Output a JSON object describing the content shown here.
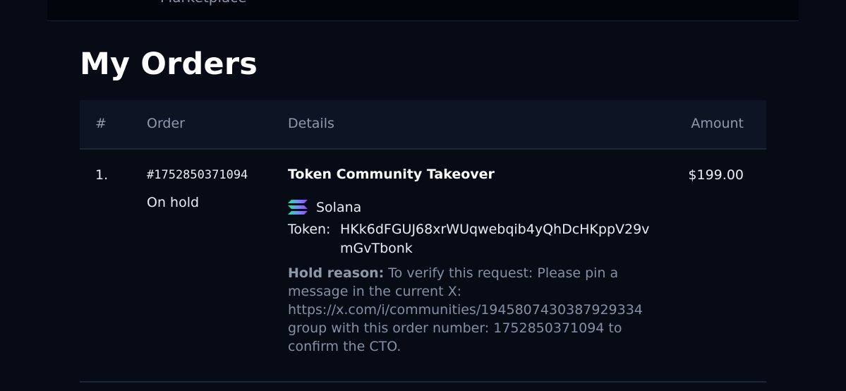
{
  "topbar": {
    "partial_text": "Marketplace"
  },
  "page": {
    "title": "My Orders"
  },
  "table": {
    "headers": {
      "num": "#",
      "order": "Order",
      "details": "Details",
      "amount": "Amount"
    },
    "rows": [
      {
        "index": "1.",
        "order_id": "#1752850371094",
        "status": "On hold",
        "product": "Token Community Takeover",
        "chain": {
          "name": "Solana",
          "icon": "solana-icon"
        },
        "token_label": "Token:",
        "token_value": "HKk6dFGUJ68xrWUqwebqib4yQhDcHKppV29vmGvTbonk",
        "hold_label": "Hold reason:",
        "hold_text": "To verify this request: Please pin a message in the current X: https://x.com/i/communities/1945807430387929334 group with this order number: 1752850371094 to confirm the CTO.",
        "amount": "$199.00"
      }
    ]
  },
  "colors": {
    "background": "#060b16",
    "header_bg": "#0d1424",
    "muted_text": "#8690a4"
  }
}
